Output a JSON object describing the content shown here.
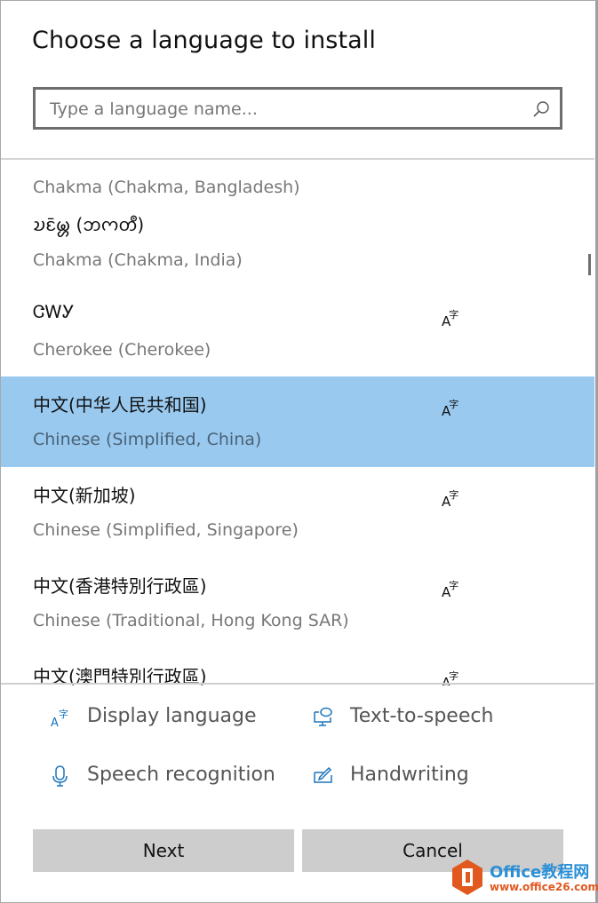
{
  "dialog": {
    "title": "Choose a language to install"
  },
  "search": {
    "placeholder": "Type a language name...",
    "value": "",
    "icon": "search-icon"
  },
  "languages": [
    {
      "native": "",
      "english": "Chakma (Chakma, Bangladesh)",
      "display_language": false,
      "selected": false
    },
    {
      "native": "𑄌𑄋𑄴𑄟𑄳𑄦 (𑄃𑄇𑄖𑄩)",
      "english": "Chakma (Chakma, India)",
      "display_language": false,
      "selected": false
    },
    {
      "native": "ᏣᎳᎩ",
      "english": "Cherokee (Cherokee)",
      "display_language": true,
      "selected": false
    },
    {
      "native": "中文(中华人民共和国)",
      "english": "Chinese (Simplified, China)",
      "display_language": true,
      "selected": true
    },
    {
      "native": "中文(新加坡)",
      "english": "Chinese (Simplified, Singapore)",
      "display_language": true,
      "selected": false
    },
    {
      "native": "中文(香港特別行政區)",
      "english": "Chinese (Traditional, Hong Kong SAR)",
      "display_language": true,
      "selected": false
    },
    {
      "native": "中文(澳門特別行政區)",
      "english": "",
      "display_language": true,
      "selected": false
    }
  ],
  "feature_icon_glyph": {
    "a": "A",
    "z": "字"
  },
  "features": [
    {
      "label": "Display language",
      "icon": "display-language-icon"
    },
    {
      "label": "Text-to-speech",
      "icon": "text-to-speech-icon"
    },
    {
      "label": "Speech recognition",
      "icon": "microphone-icon"
    },
    {
      "label": "Handwriting",
      "icon": "handwriting-icon"
    }
  ],
  "buttons": {
    "next": "Next",
    "cancel": "Cancel"
  },
  "watermark": {
    "title": "Office教程网",
    "url": "www.office26.com"
  },
  "colors": {
    "selected_bg": "#99c9ef",
    "accent": "#1c75bc",
    "button_bg": "#cdcdcd"
  }
}
